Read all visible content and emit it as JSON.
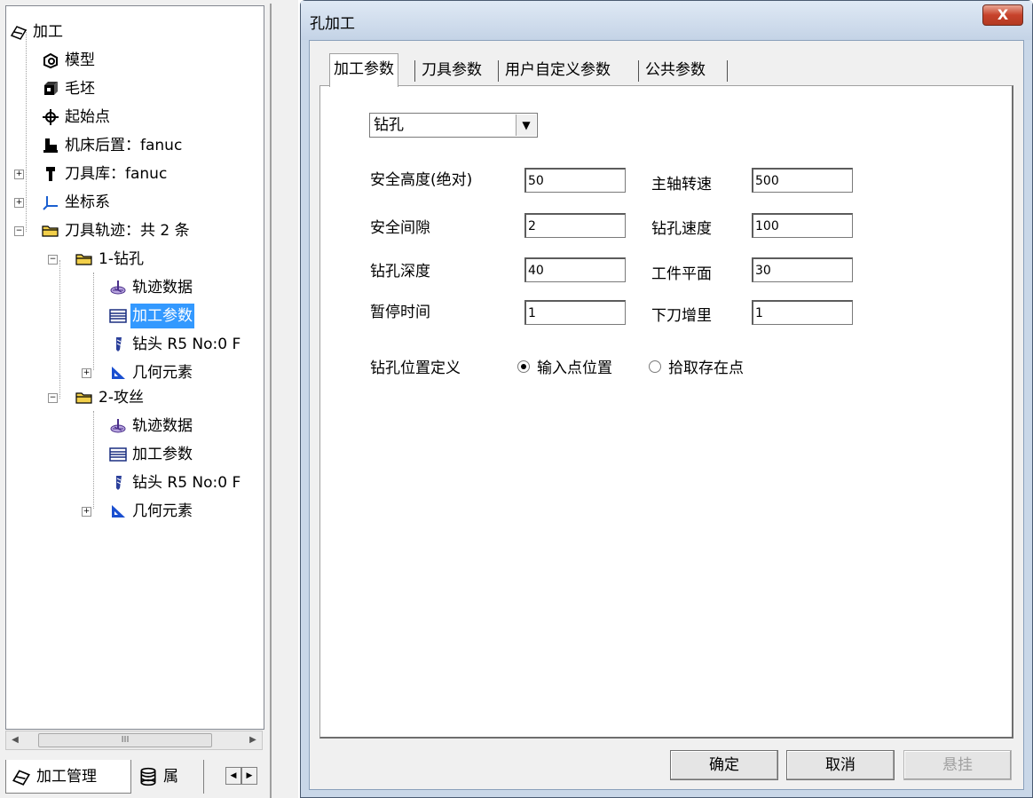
{
  "tree": {
    "items": [
      {
        "label": "加工",
        "icon": "machining-icon"
      },
      {
        "label": "模型",
        "icon": "model-icon"
      },
      {
        "label": "毛坯",
        "icon": "blank-icon"
      },
      {
        "label": "起始点",
        "icon": "start-point-icon"
      },
      {
        "label": "机床后置：fanuc",
        "icon": "machine-post-icon"
      },
      {
        "label": "刀具库：fanuc",
        "icon": "tool-library-icon"
      },
      {
        "label": "坐标系",
        "icon": "coordinate-system-icon"
      },
      {
        "label": "刀具轨迹：共 2 条",
        "icon": "folder-icon"
      },
      {
        "label": "1-钻孔",
        "icon": "folder-icon"
      },
      {
        "label": "轨迹数据",
        "icon": "toolpath-data-icon"
      },
      {
        "label": "加工参数",
        "icon": "parameters-icon",
        "selected": true
      },
      {
        "label": "钻头 R5 No:0 F",
        "icon": "drill-bit-icon"
      },
      {
        "label": "几何元素",
        "icon": "geometry-icon"
      },
      {
        "label": "2-攻丝",
        "icon": "folder-icon"
      },
      {
        "label": "轨迹数据",
        "icon": "toolpath-data-icon"
      },
      {
        "label": "加工参数",
        "icon": "parameters-icon"
      },
      {
        "label": "钻头 R5 No:0 F",
        "icon": "drill-bit-icon"
      },
      {
        "label": "几何元素",
        "icon": "geometry-icon"
      }
    ]
  },
  "scrollbar": {
    "thumb_label": "III"
  },
  "bottom_tabs": [
    {
      "label": "加工管理",
      "icon": "machining-icon"
    },
    {
      "label": "属",
      "icon": "database-icon"
    }
  ],
  "dialog": {
    "title": "孔加工",
    "close_label": "X",
    "tabs": [
      "加工参数",
      "刀具参数",
      "用户自定义参数",
      "公共参数"
    ],
    "mode": "钻孔",
    "params": {
      "safe_height_label": "安全高度(绝对)",
      "safe_height": "50",
      "spindle_speed_label": "主轴转速",
      "spindle_speed": "500",
      "safe_gap_label": "安全间隙",
      "safe_gap": "2",
      "drill_speed_label": "钻孔速度",
      "drill_speed": "100",
      "drill_depth_label": "钻孔深度",
      "drill_depth": "40",
      "work_plane_label": "工件平面",
      "work_plane": "30",
      "dwell_time_label": "暂停时间",
      "dwell_time": "1",
      "down_step_label": "下刀增里",
      "down_step": "1"
    },
    "position_label": "钻孔位置定义",
    "radio_input": "输入点位置",
    "radio_pick": "拾取存在点",
    "ok_label": "确定",
    "cancel_label": "取消",
    "suspend_label": "悬挂"
  }
}
